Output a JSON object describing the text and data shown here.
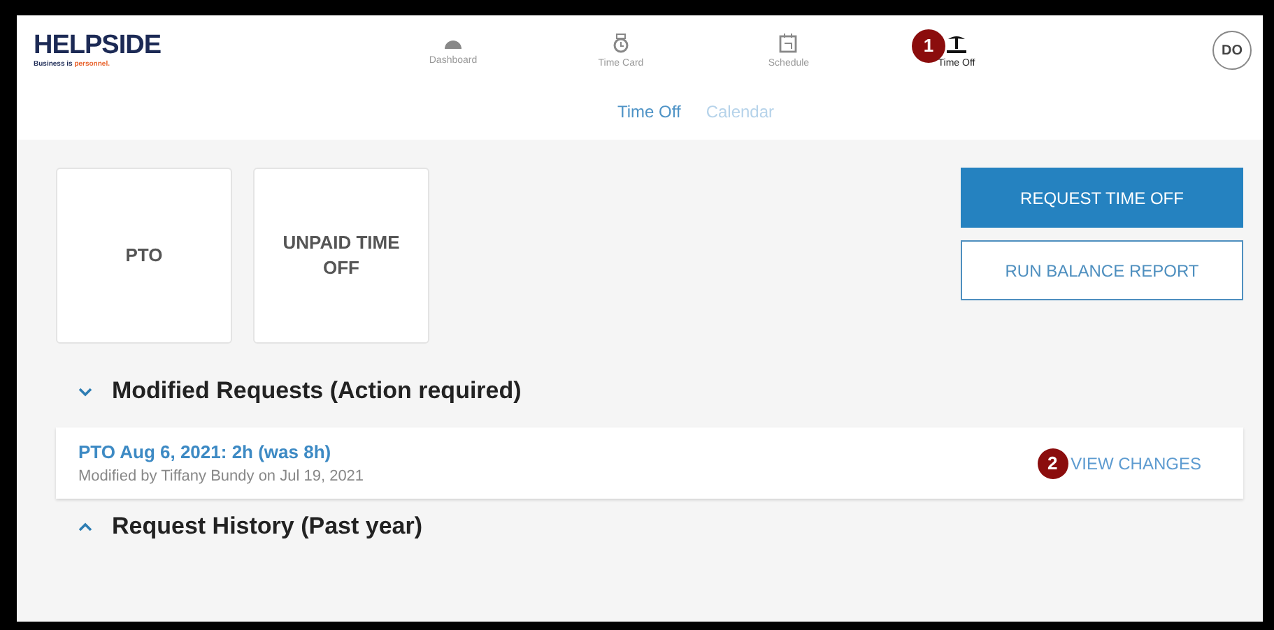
{
  "brand": {
    "name": "HELPSIDE",
    "tagline_start": "Business is ",
    "tagline_end": "personnel."
  },
  "nav": [
    {
      "label": "Dashboard",
      "selected": false
    },
    {
      "label": "Time Card",
      "selected": false
    },
    {
      "label": "Schedule",
      "selected": false
    },
    {
      "label": "Time Off",
      "selected": true,
      "callout": "1"
    }
  ],
  "avatar": "DO",
  "subtabs": [
    {
      "label": "Time Off",
      "selected": true
    },
    {
      "label": "Calendar",
      "selected": false
    }
  ],
  "balances": [
    {
      "label": "PTO"
    },
    {
      "label": "UNPAID TIME OFF"
    }
  ],
  "actions": [
    {
      "label": "REQUEST TIME OFF",
      "kind": "primary"
    },
    {
      "label": "RUN BALANCE REPORT",
      "kind": "outline"
    }
  ],
  "sections": [
    {
      "title": "Modified Requests (Action required)",
      "expanded": true,
      "items": [
        {
          "title": "PTO Aug 6, 2021: 2h (was 8h)",
          "subtitle": "Modified by Tiffany Bundy on Jul 19, 2021",
          "action": "VIEW CHANGES",
          "callout": "2"
        }
      ]
    },
    {
      "title": "Request History (Past year)",
      "expanded": false
    }
  ]
}
